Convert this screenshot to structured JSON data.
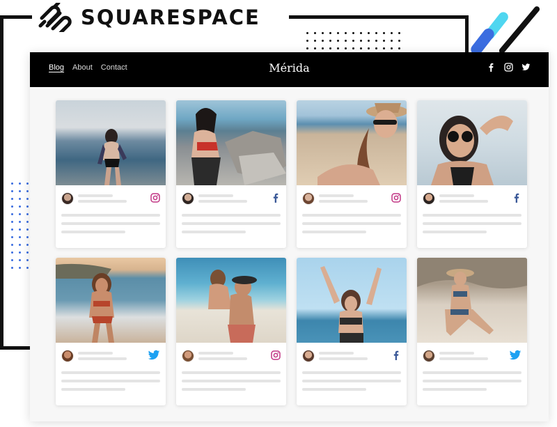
{
  "logo": {
    "wordmark": "SQUARESPACE",
    "icon": "squarespace-logo-icon"
  },
  "site": {
    "title": "Mérida",
    "nav": [
      {
        "label": "Blog",
        "active": true
      },
      {
        "label": "About",
        "active": false
      },
      {
        "label": "Contact",
        "active": false
      }
    ],
    "social_icons": [
      "facebook-icon",
      "instagram-icon",
      "twitter-icon"
    ]
  },
  "posts": [
    {
      "source": "instagram-icon",
      "scene": "woman in bikini on the sea shore"
    },
    {
      "source": "facebook-icon",
      "scene": "woman sitting on rocks by the sea"
    },
    {
      "source": "instagram-icon",
      "scene": "woman in sun hat on the beach"
    },
    {
      "source": "facebook-icon",
      "scene": "woman in sunglasses close-up"
    },
    {
      "source": "twitter-icon",
      "scene": "woman in bikini standing in the surf"
    },
    {
      "source": "instagram-icon",
      "scene": "couple with piggyback on the beach"
    },
    {
      "source": "facebook-icon",
      "scene": "woman with raised arms by the sea"
    },
    {
      "source": "twitter-icon",
      "scene": "woman in hat sitting on the sand"
    }
  ],
  "colors": {
    "topbar": "#000000",
    "accent_blue": "#3b6de0",
    "accent_cyan": "#4fd6f0",
    "placeholder": "#e4e4e4",
    "instagram": "#c13584",
    "facebook": "#3b5998",
    "twitter": "#1da1f2"
  }
}
